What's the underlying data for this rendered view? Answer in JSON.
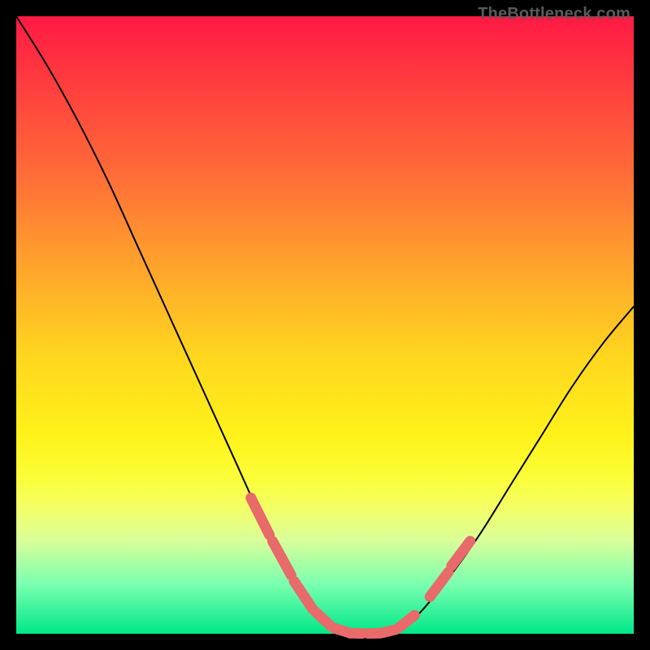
{
  "watermark": "TheBottleneck.com",
  "chart_data": {
    "type": "line",
    "title": "",
    "xlabel": "",
    "ylabel": "",
    "xlim": [
      0,
      100
    ],
    "ylim": [
      0,
      100
    ],
    "series": [
      {
        "name": "left-curve",
        "x": [
          0,
          5,
          10,
          15,
          20,
          25,
          30,
          35,
          40,
          44,
          48,
          50,
          52
        ],
        "values": [
          100,
          92,
          83,
          73,
          62,
          51,
          40,
          29,
          18,
          10,
          4,
          2,
          0.5
        ]
      },
      {
        "name": "valley-floor",
        "x": [
          52,
          54,
          56,
          58,
          60,
          62
        ],
        "values": [
          0.5,
          0,
          0,
          0,
          0,
          0.5
        ]
      },
      {
        "name": "right-curve",
        "x": [
          62,
          65,
          70,
          75,
          80,
          85,
          90,
          95,
          100
        ],
        "values": [
          0.5,
          3,
          9,
          16,
          24,
          32,
          40,
          47,
          53
        ]
      }
    ],
    "markers": [
      {
        "segment_x": [
          38,
          41
        ],
        "segment_y": [
          22,
          16
        ],
        "group": "left"
      },
      {
        "segment_x": [
          41.5,
          44.5
        ],
        "segment_y": [
          15,
          9.5
        ],
        "group": "left"
      },
      {
        "segment_x": [
          45,
          48
        ],
        "segment_y": [
          8.5,
          4
        ],
        "group": "left"
      },
      {
        "segment_x": [
          48.5,
          51
        ],
        "segment_y": [
          3.5,
          1.2
        ],
        "group": "left"
      },
      {
        "segment_x": [
          51.5,
          53.5
        ],
        "segment_y": [
          0.9,
          0.3
        ],
        "group": "floor"
      },
      {
        "segment_x": [
          54,
          56
        ],
        "segment_y": [
          0.1,
          0.05
        ],
        "group": "floor"
      },
      {
        "segment_x": [
          57,
          59
        ],
        "segment_y": [
          0.05,
          0.1
        ],
        "group": "floor"
      },
      {
        "segment_x": [
          59.5,
          61.5
        ],
        "segment_y": [
          0.2,
          0.7
        ],
        "group": "floor"
      },
      {
        "segment_x": [
          62,
          64.5
        ],
        "segment_y": [
          1,
          3
        ],
        "group": "right"
      },
      {
        "segment_x": [
          67,
          70
        ],
        "segment_y": [
          6,
          10
        ],
        "group": "right"
      },
      {
        "segment_x": [
          70.5,
          73.5
        ],
        "segment_y": [
          11,
          15
        ],
        "group": "right"
      }
    ],
    "marker_color": "#e86a6a",
    "curve_color": "#000000"
  }
}
